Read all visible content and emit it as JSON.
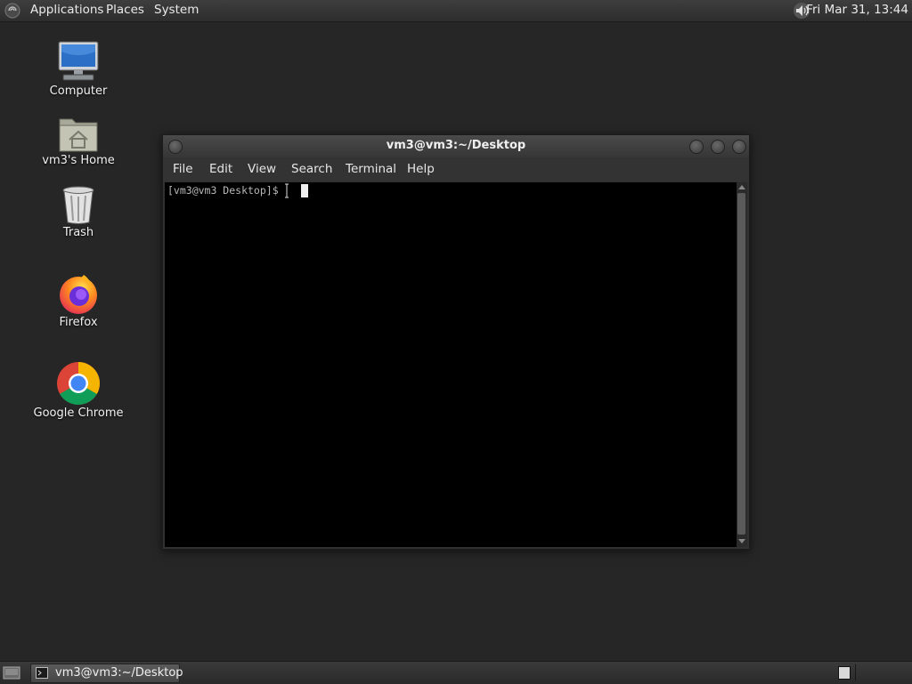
{
  "top_panel": {
    "menus": [
      "Applications",
      "Places",
      "System"
    ],
    "clock": "Fri Mar 31, 13:44",
    "icons": {
      "logo": "gnome-foot-icon",
      "volume": "speaker-volume-icon"
    }
  },
  "desktop": {
    "icons": [
      {
        "label": "Computer",
        "icon": "computer-monitor-icon"
      },
      {
        "label": "vm3's Home",
        "icon": "home-folder-icon"
      },
      {
        "label": "Trash",
        "icon": "trash-can-icon"
      },
      {
        "label": "Firefox",
        "icon": "firefox-icon"
      },
      {
        "label": "Google Chrome",
        "icon": "chrome-icon"
      }
    ]
  },
  "terminal": {
    "title": "vm3@vm3:~/Desktop",
    "menu": [
      "File",
      "Edit",
      "View",
      "Search",
      "Terminal",
      "Help"
    ],
    "prompt": "[vm3@vm3 Desktop]$ "
  },
  "bottom_panel": {
    "task_label": "vm3@vm3:~/Desktop",
    "icons": {
      "show_desktop": "show-desktop-icon",
      "task": "terminal-icon"
    }
  },
  "colors": {
    "desktop_bg": "#262626",
    "panel_bg": "#333333",
    "terminal_bg": "#000000",
    "terminal_fg": "#b8b8b8"
  }
}
